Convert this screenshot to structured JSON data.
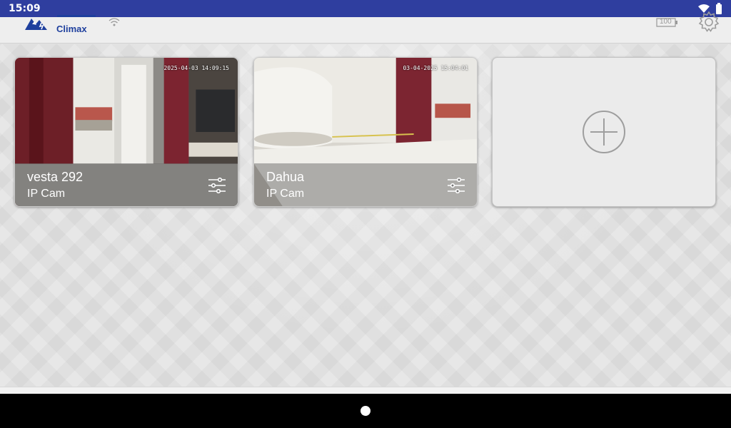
{
  "status_bar": {
    "time": "15:09",
    "icons": [
      "wifi-icon",
      "battery-icon"
    ]
  },
  "header": {
    "logo_text": "Climax",
    "battery_label": "100",
    "icons": [
      "wifi-signal-icon",
      "battery-level-icon",
      "gear-icon"
    ]
  },
  "cameras": [
    {
      "name": "vesta 292",
      "type": "IP Cam",
      "timestamp": "2025-04-03 14:09:15"
    },
    {
      "name": "Dahua",
      "type": "IP Cam",
      "timestamp": "03-04-2025 15:04:01"
    }
  ],
  "add_card": {
    "icon": "plus-circle-icon"
  },
  "colors": {
    "status_bar": "#2f3e9f",
    "brand_blue": "#1e3f9d",
    "background": "#e2e2e2"
  }
}
